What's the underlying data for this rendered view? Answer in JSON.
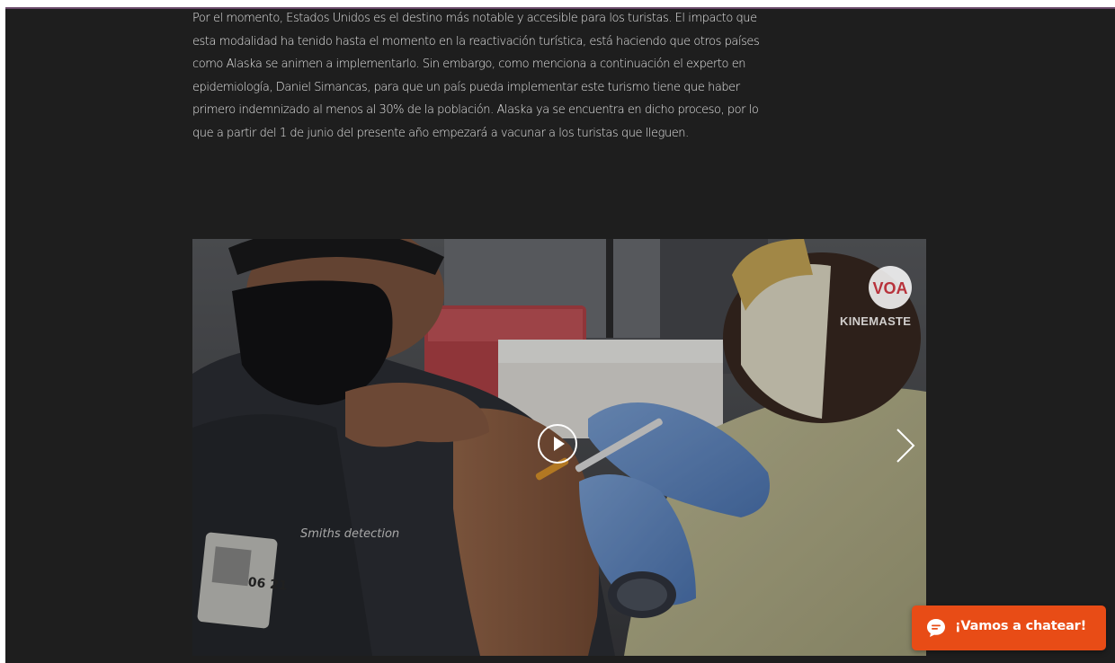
{
  "article": {
    "lines": [
      " Por el momento, Estados Unidos es el destino más notable y accesible para los turistas. El impacto que",
      "esta modalidad ha tenido hasta el momento en la reactivación turística, está haciendo que otros países",
      "como Alaska se animen a implementarlo. Sin embargo, como menciona a continuación el experto en",
      "epidemiología, Daniel Simancas, para que un país pueda implementar este turismo tiene que haber",
      "primero indemnizado al menos al 30% de la población. Alaska ya se encuentra en dicho proceso, por lo",
      "que a partir del 1 de junio del presente año empezará a vacunar a los turistas que lleguen."
    ]
  },
  "video": {
    "watermark": "KINEMASTE",
    "logo_text": "VOA",
    "shirt_text": "Smiths detection",
    "badge_text": "06 21",
    "controls": {
      "play_icon": "play-circle-icon",
      "next_icon": "chevron-right-icon"
    }
  },
  "chat": {
    "label": "¡Vamos a chatear!",
    "icon": "chat-bubble-icon",
    "color": "#e84c16"
  },
  "colors": {
    "page_background": "#1e1e1e",
    "text": "#e6e6e6"
  }
}
